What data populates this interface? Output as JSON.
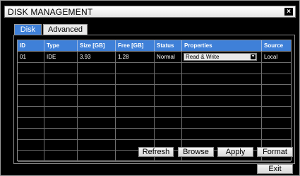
{
  "window": {
    "title": "DISK MANAGEMENT",
    "close_label": "×"
  },
  "tabs": [
    {
      "label": "Disk",
      "active": true
    },
    {
      "label": "Advanced",
      "active": false
    }
  ],
  "table": {
    "headers": [
      "ID",
      "Type",
      "Size [GB]",
      "Free [GB]",
      "Status",
      "Properties",
      "Source"
    ],
    "rows": [
      {
        "id": "01",
        "type": "IDE",
        "size": "3.93",
        "free": "1.28",
        "status": "Normal",
        "properties": "Read & Write",
        "source": "Local"
      }
    ],
    "empty_rows": 9
  },
  "buttons": {
    "refresh": "Refresh",
    "browse": "Browse",
    "apply": "Apply",
    "format": "Format",
    "exit": "Exit"
  },
  "colors": {
    "accent": "#3f80d8",
    "background": "#000000"
  }
}
